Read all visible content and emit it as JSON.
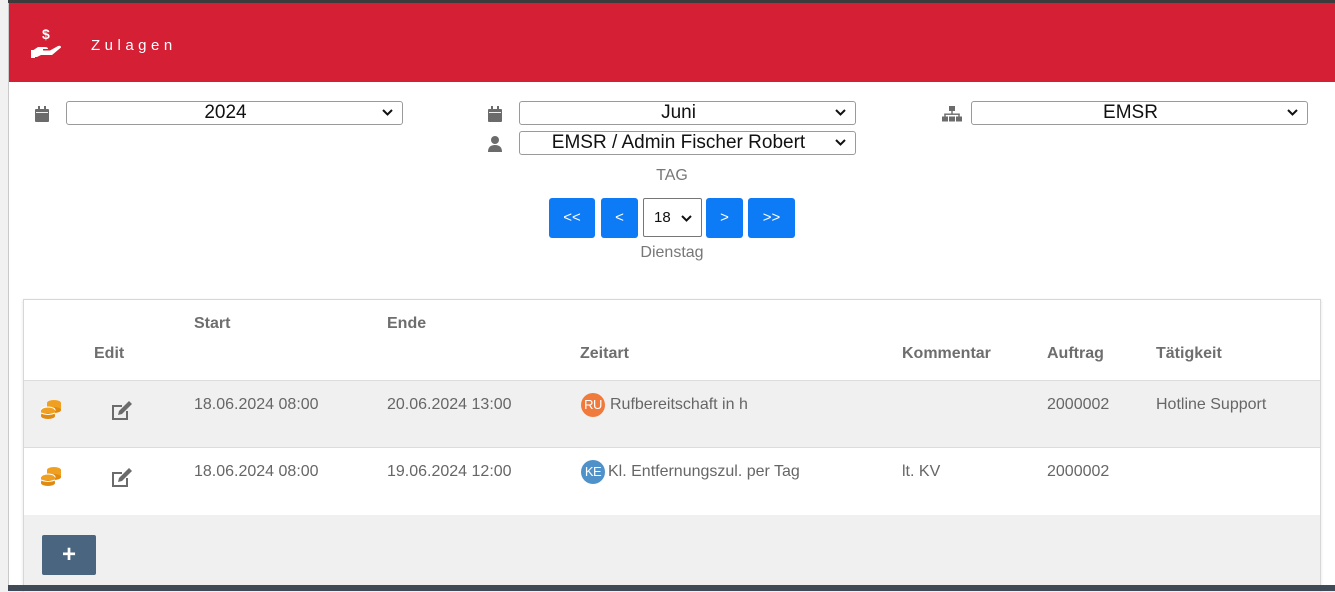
{
  "header": {
    "title": "Zulagen",
    "icon": "hand-dollar-icon",
    "color": "#d41f34"
  },
  "filters": {
    "year": "2024",
    "month": "Juni",
    "department": "EMSR",
    "employee": "EMSR / Admin Fischer Robert"
  },
  "day_nav": {
    "label": "TAG",
    "first": "<<",
    "prev": "<",
    "day": "18",
    "next": ">",
    "last": ">>",
    "weekday": "Dienstag",
    "button_color": "#0d7bf6"
  },
  "table": {
    "headers": {
      "edit": "Edit",
      "start": "Start",
      "end": "Ende",
      "type": "Zeitart",
      "comment": "Kommentar",
      "order": "Auftrag",
      "activity": "Tätigkeit"
    },
    "rows": [
      {
        "start": "18.06.2024 08:00",
        "end": "20.06.2024 13:00",
        "badge": "RU",
        "badge_color": "#f07a3c",
        "type": "Rufbereitschaft in h",
        "comment": "",
        "order": "2000002",
        "activity": "Hotline Support"
      },
      {
        "start": "18.06.2024 08:00",
        "end": "19.06.2024 12:00",
        "badge": "KE",
        "badge_color": "#4f92c9",
        "type": "Kl. Entfernungszul. per Tag",
        "comment": "lt. KV",
        "order": "2000002",
        "activity": ""
      }
    ],
    "add_label": "+"
  }
}
